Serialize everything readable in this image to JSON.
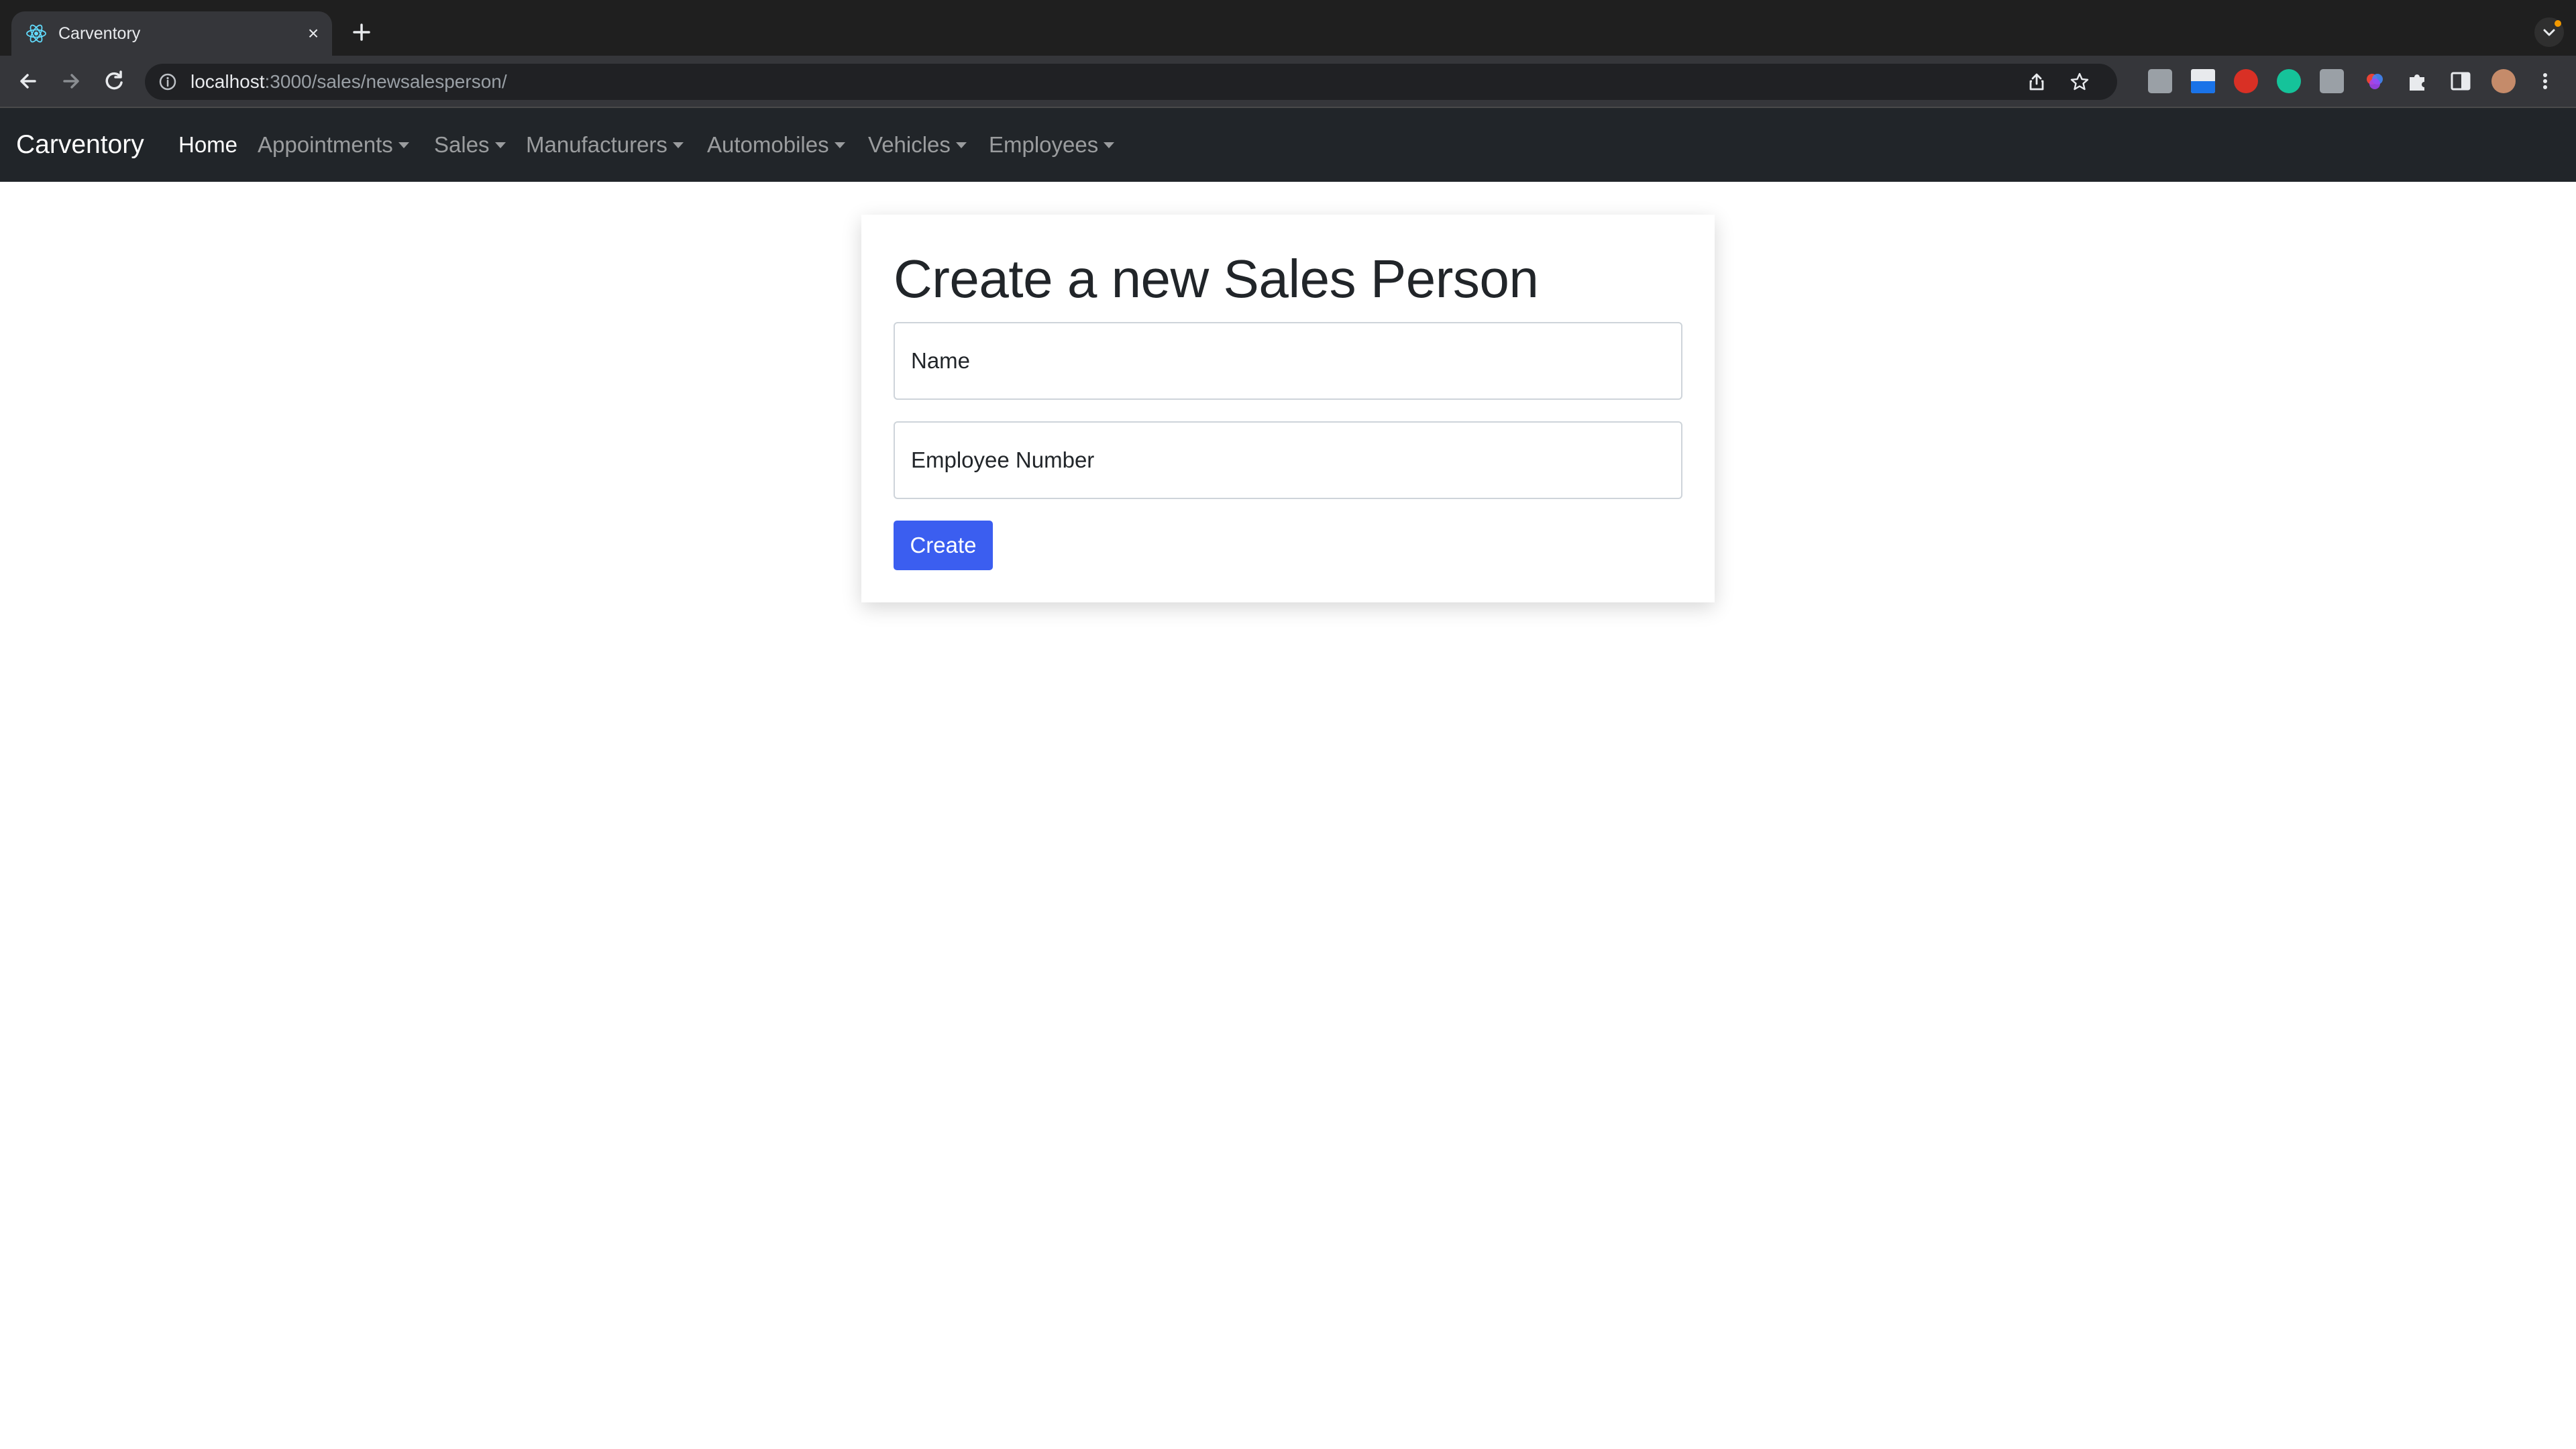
{
  "browser": {
    "tab": {
      "title": "Carventory",
      "favicon": "react-atom-icon"
    },
    "url": {
      "host": "localhost",
      "rest": ":3000/sales/newsalesperson/"
    },
    "extensions": [
      "extension-gray-icon",
      "extension-blue-icon",
      "extension-red-icon",
      "grammarly-icon",
      "extension-bolt-icon",
      "extension-color-icon",
      "puzzle-icon",
      "sidepanel-icon",
      "profile-avatar"
    ]
  },
  "navbar": {
    "brand": "Carventory",
    "items": [
      {
        "label": "Home",
        "active": true,
        "dropdown": false
      },
      {
        "label": "Appointments",
        "active": false,
        "dropdown": true
      },
      {
        "label": "Sales",
        "active": false,
        "dropdown": true
      },
      {
        "label": "Manufacturers",
        "active": false,
        "dropdown": true
      },
      {
        "label": "Automobiles",
        "active": false,
        "dropdown": true
      },
      {
        "label": "Vehicles",
        "active": false,
        "dropdown": true
      },
      {
        "label": "Employees",
        "active": false,
        "dropdown": true
      }
    ]
  },
  "form": {
    "title": "Create a new Sales Person",
    "name_placeholder": "Name",
    "name_value": "",
    "employee_number_placeholder": "Employee Number",
    "employee_number_value": "",
    "submit_label": "Create"
  },
  "colors": {
    "navbar_bg": "#212529",
    "primary_button": "#3b5ef0",
    "chrome_bg": "#35363a"
  }
}
